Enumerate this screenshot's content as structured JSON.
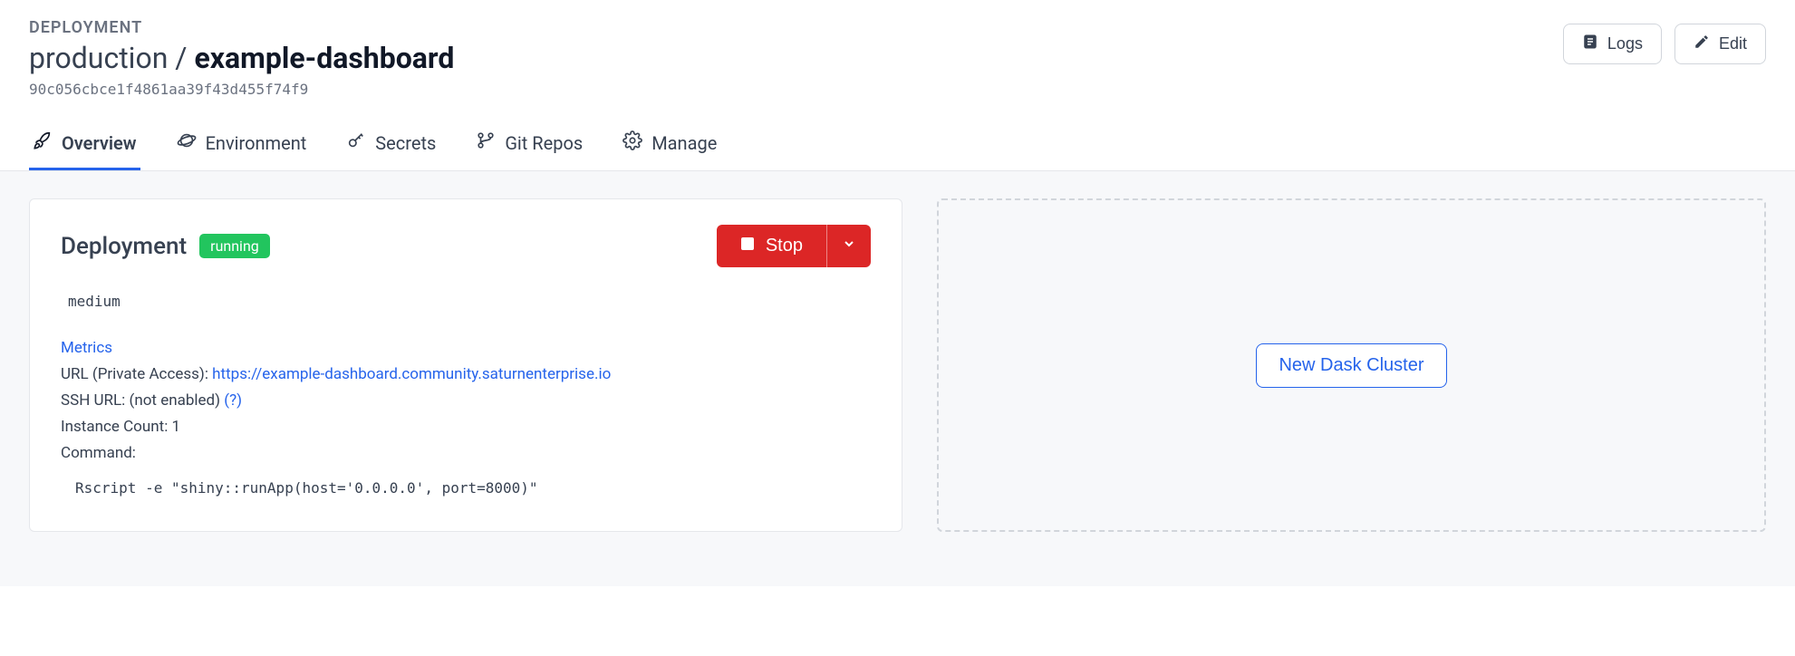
{
  "header": {
    "overline": "DEPLOYMENT",
    "breadcrumb_root": "production",
    "breadcrumb_sep": " / ",
    "breadcrumb_name": "example-dashboard",
    "hash": "90c056cbce1f4861aa39f43d455f74f9",
    "logs_label": "Logs",
    "edit_label": "Edit"
  },
  "tabs": {
    "overview": "Overview",
    "environment": "Environment",
    "secrets": "Secrets",
    "git_repos": "Git Repos",
    "manage": "Manage"
  },
  "card": {
    "title": "Deployment",
    "status": "running",
    "stop_label": "Stop",
    "size": "medium",
    "metrics_label": "Metrics",
    "url_label": "URL (Private Access): ",
    "url_value": "https://example-dashboard.community.saturnenterprise.io",
    "ssh_label": "SSH URL: (not enabled) ",
    "ssh_help": "(?)",
    "instance_count_label": "Instance Count: ",
    "instance_count_value": "1",
    "command_label": "Command:",
    "command_value": "Rscript -e \"shiny::runApp(host='0.0.0.0', port=8000)\""
  },
  "cluster": {
    "new_label": "New Dask Cluster"
  }
}
